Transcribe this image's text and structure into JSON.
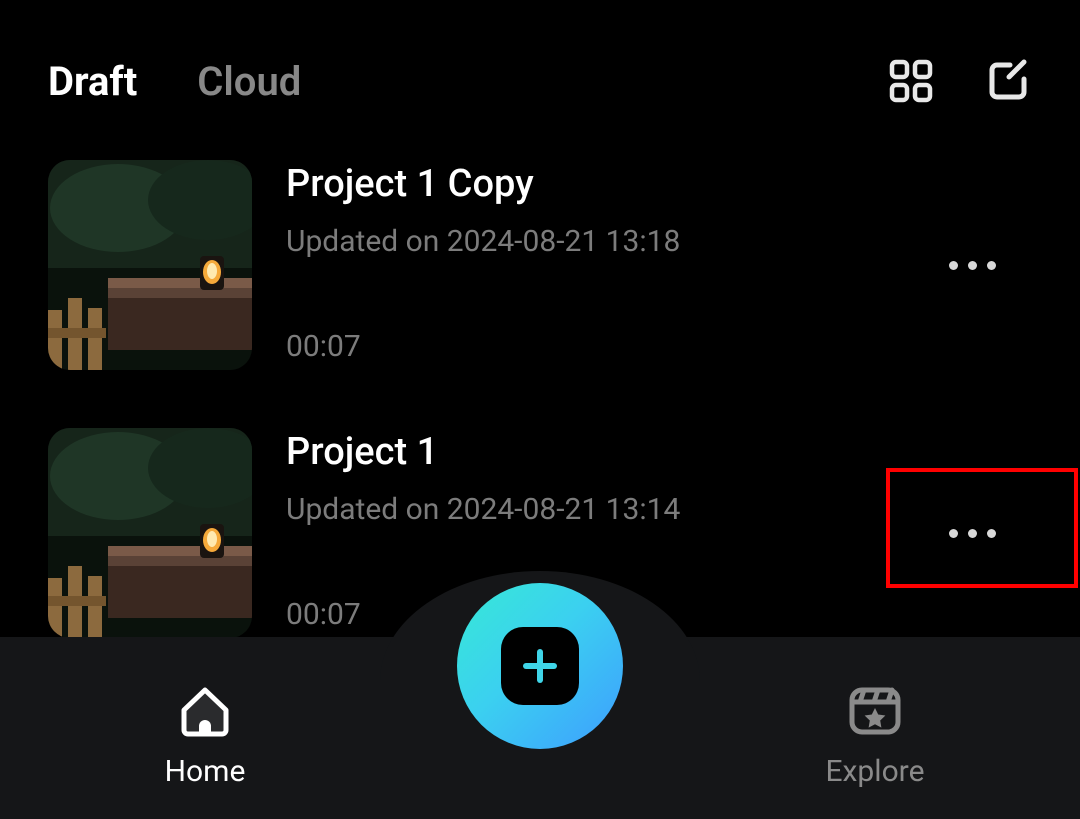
{
  "tabs": {
    "draft": "Draft",
    "cloud": "Cloud",
    "active": "draft"
  },
  "header_icons": {
    "grid": "grid-view-icon",
    "edit": "edit-icon"
  },
  "projects": [
    {
      "title": "Project 1 Copy",
      "updated": "Updated on 2024-08-21 13:18",
      "duration": "00:07",
      "highlighted": false
    },
    {
      "title": "Project 1",
      "updated": "Updated on 2024-08-21 13:14",
      "duration": "00:07",
      "highlighted": true
    }
  ],
  "nav": {
    "home": "Home",
    "explore": "Explore"
  }
}
